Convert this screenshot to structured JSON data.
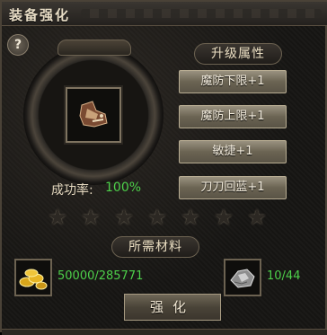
{
  "window": {
    "title": "装备强化"
  },
  "help": {
    "symbol": "?"
  },
  "equipment": {
    "icon": "boots-icon"
  },
  "success_rate": {
    "label": "成功率:",
    "value": "100%"
  },
  "upgrade_attributes": {
    "header": "升级属性",
    "items": [
      {
        "label": "魔防下限+1"
      },
      {
        "label": "魔防上限+1"
      },
      {
        "label": "敏捷+1"
      },
      {
        "label": "刀刀回蓝+1"
      }
    ]
  },
  "stars": {
    "total": 7,
    "filled": 0
  },
  "materials": {
    "header": "所需材料",
    "gold": {
      "icon": "gold-coins-icon",
      "amount": "50000/285771"
    },
    "ore": {
      "icon": "silver-ore-icon",
      "amount": "10/44"
    }
  },
  "action": {
    "label": "强化"
  },
  "colors": {
    "accent_green": "#4dd04a",
    "text_beige": "#e4d8bf",
    "star_dark": "#2c2823"
  }
}
